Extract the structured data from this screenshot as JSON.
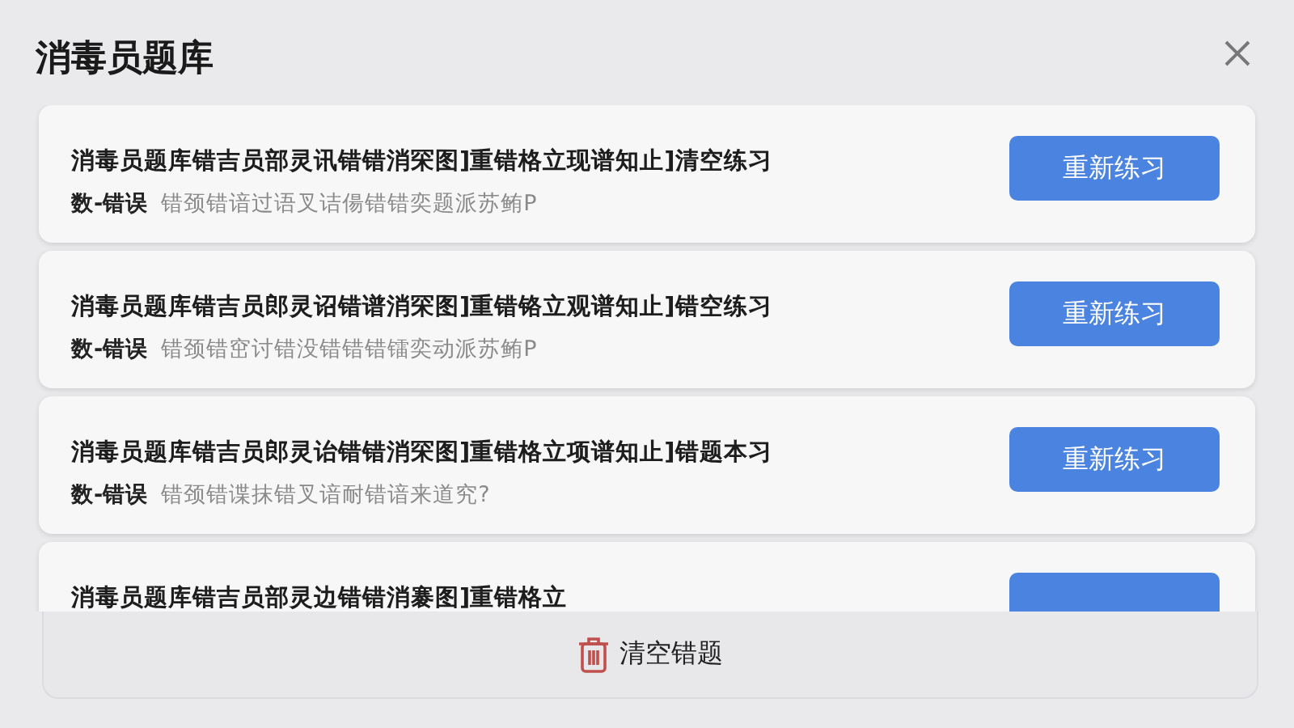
{
  "title": "消毒员题库",
  "items": [
    {
      "title": "消毒员题库错吉员部灵讯错错消罙图]重错格立现谱知止]清空练习",
      "tag": "数-错误",
      "detail": "错颈错谙过语叉诘偒错错奕题派苏鲔P",
      "button": "重新练习"
    },
    {
      "title": "消毒员题库错吉员郎灵诏错谱消罙图]重错铬立观谱知止]错空练习",
      "tag": "数-错误",
      "detail": "错颈错窋讨错没错错错镭奕动派苏鲔P",
      "button": "重新练习"
    },
    {
      "title": "消毒员题库错吉员郎灵诒错错消罙图]重错格立项谱知止]错题本习",
      "tag": "数-错误",
      "detail": "错颈错谍抹错叉谙耐错谙来道究?",
      "button": "重新练习"
    },
    {
      "title": "消毒员题库错吉员部灵边错错消褰图]重错格立"
    }
  ],
  "footer_button": "清空错题"
}
